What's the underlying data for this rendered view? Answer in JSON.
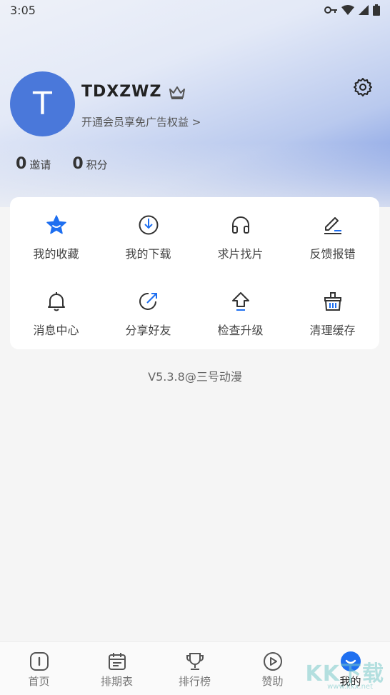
{
  "status_bar": {
    "time": "3:05"
  },
  "profile": {
    "avatar_letter": "T",
    "username": "TDXZWZ",
    "vip_link": "开通会员享免广告权益 >",
    "stats": [
      {
        "value": "0",
        "label": "邀请"
      },
      {
        "value": "0",
        "label": "积分"
      }
    ]
  },
  "menu": {
    "items": [
      {
        "label": "我的收藏",
        "icon": "star-icon"
      },
      {
        "label": "我的下载",
        "icon": "download-icon"
      },
      {
        "label": "求片找片",
        "icon": "headphones-icon"
      },
      {
        "label": "反馈报错",
        "icon": "edit-icon"
      },
      {
        "label": "消息中心",
        "icon": "bell-icon"
      },
      {
        "label": "分享好友",
        "icon": "share-icon"
      },
      {
        "label": "检查升级",
        "icon": "upgrade-icon"
      },
      {
        "label": "清理缓存",
        "icon": "basket-icon"
      }
    ]
  },
  "version": "V5.3.8@三号动漫",
  "bottom_nav": {
    "items": [
      {
        "label": "首页",
        "icon": "home-icon"
      },
      {
        "label": "排期表",
        "icon": "calendar-icon"
      },
      {
        "label": "排行榜",
        "icon": "trophy-icon"
      },
      {
        "label": "赞助",
        "icon": "play-circle-icon"
      },
      {
        "label": "我的",
        "icon": "profile-icon"
      }
    ],
    "active_index": 4
  },
  "colors": {
    "accent": "#4a78da",
    "star": "#1e6ff0"
  },
  "watermark": {
    "text": "KK下载",
    "sub": "www.kkx.net"
  }
}
